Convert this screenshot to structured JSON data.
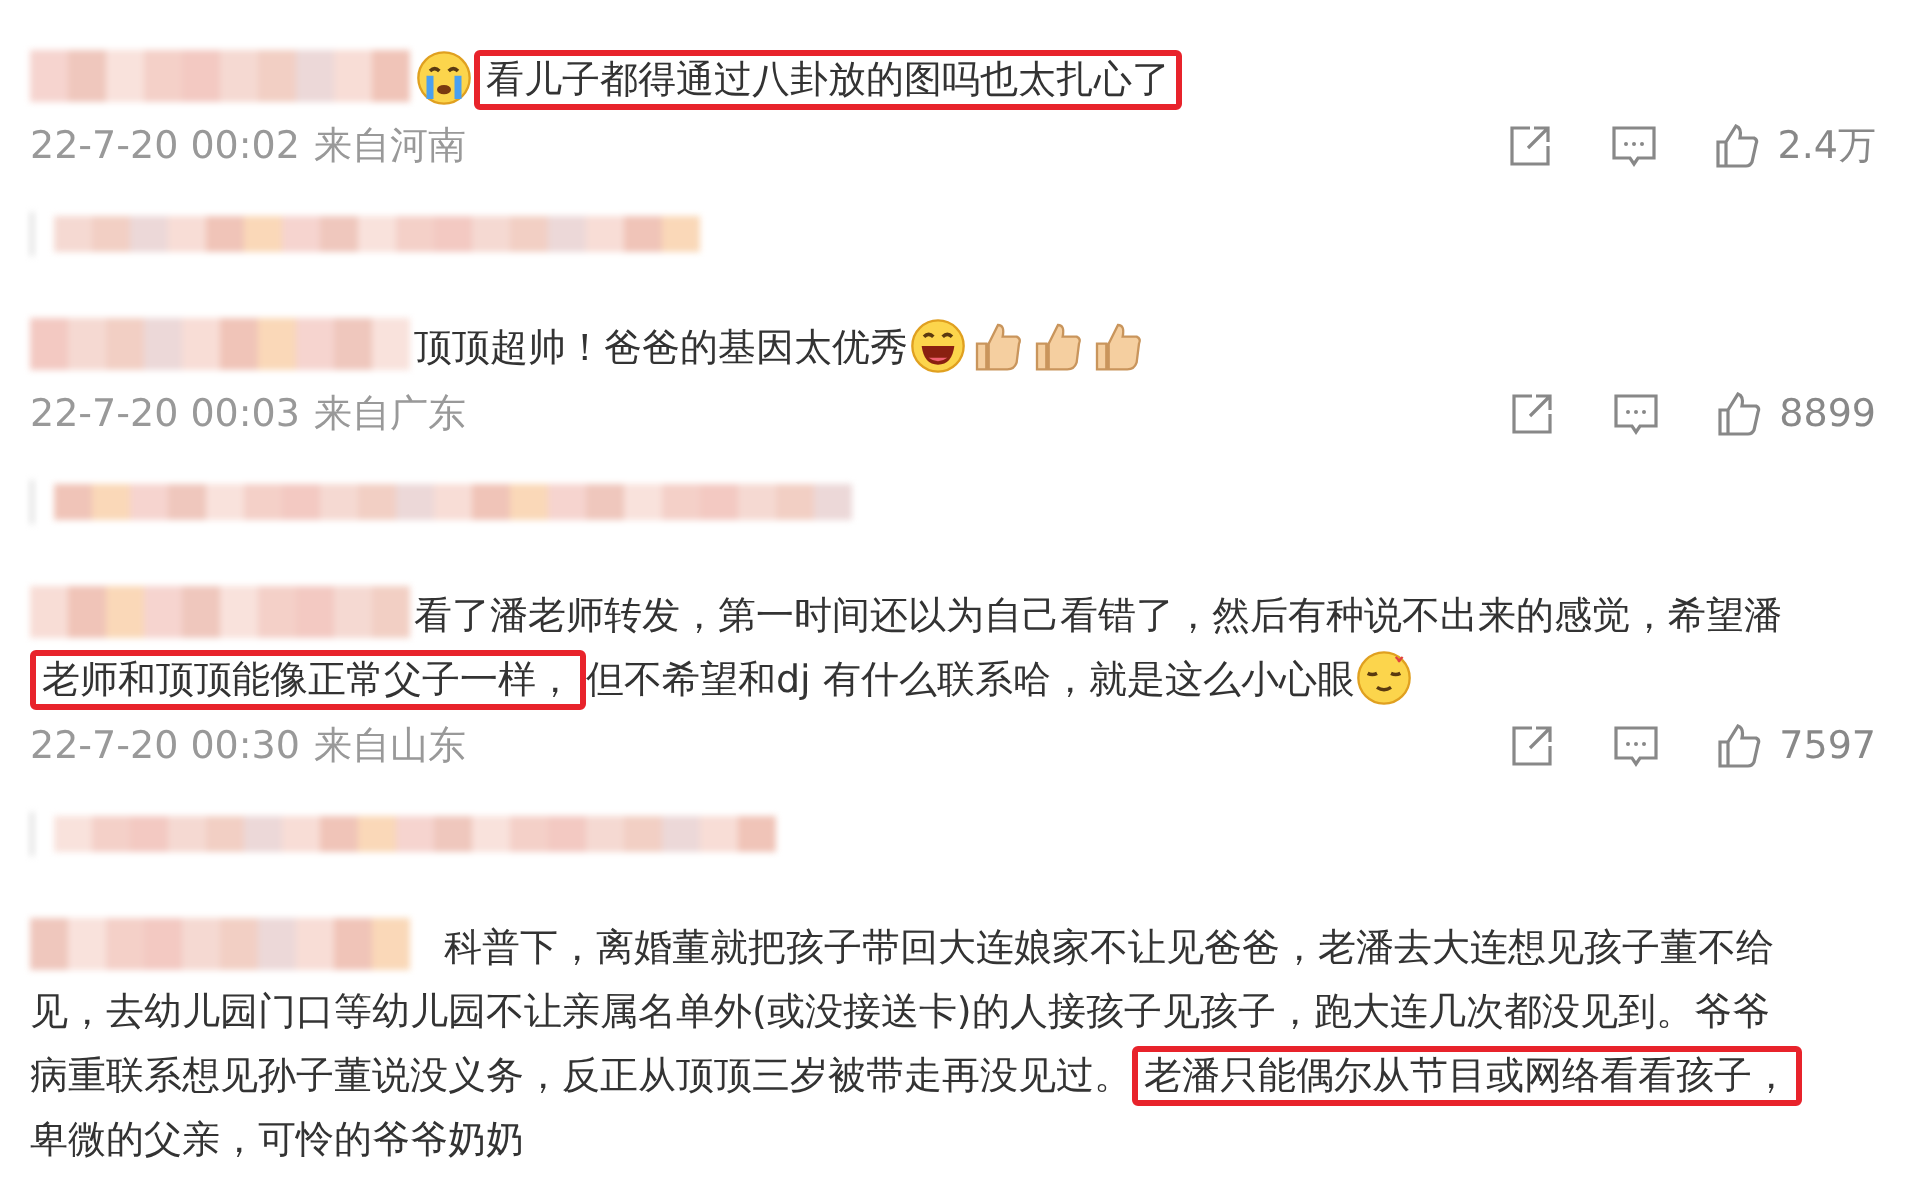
{
  "comments": [
    {
      "lines": [
        [
          {
            "kind": "crying"
          },
          {
            "kind": "text",
            "text": "看儿子都得通过八卦放的图吗也太扎心了",
            "highlighted": true
          }
        ]
      ],
      "date": "22-7-20 00:02",
      "location": "来自河南",
      "likes": "2.4万"
    },
    {
      "lines": [
        [
          {
            "kind": "text",
            "text": "顶顶超帅！爸爸的基因太优秀",
            "highlighted": false
          },
          {
            "kind": "grin"
          },
          {
            "kind": "thumb"
          },
          {
            "kind": "thumb"
          },
          {
            "kind": "thumb"
          }
        ]
      ],
      "date": "22-7-20 00:03",
      "location": "来自广东",
      "likes": "8899"
    },
    {
      "lines": [
        [
          {
            "kind": "text",
            "text": "看了潘老师转发，第一时间还以为自己看错了，然后有种说不出来的感觉，希望潘",
            "highlighted": false
          }
        ],
        [
          {
            "kind": "text",
            "text": "老师和顶顶能像正常父子一样，",
            "highlighted": true
          },
          {
            "kind": "text",
            "text": "但不希望和dj 有什么联系哈，就是这么小心眼",
            "highlighted": false
          },
          {
            "kind": "dizzy"
          }
        ]
      ],
      "date": "22-7-20 00:30",
      "location": "来自山东",
      "likes": "7597"
    },
    {
      "lines": [
        [
          {
            "kind": "text",
            "text": "科普下，离婚董就把孩子带回大连娘家不让见爸爸，老潘去大连想见孩子董不给",
            "highlighted": false
          }
        ],
        [
          {
            "kind": "text",
            "text": "见，去幼儿园门口等幼儿园不让亲属名单外(或没接送卡)的人接孩子见孩子，跑大连几次都没见到。爷爷",
            "highlighted": false
          }
        ],
        [
          {
            "kind": "text",
            "text": "病重联系想见孙子董说没义务，反正从顶顶三岁被带走再没见过。",
            "highlighted": false
          },
          {
            "kind": "text",
            "text": "老潘只能偶尔从节目或网络看看孩子，",
            "highlighted": true
          }
        ],
        [
          {
            "kind": "text",
            "text": "卑微的父亲，可怜的爷爷奶奶",
            "highlighted": false
          }
        ]
      ]
    }
  ]
}
